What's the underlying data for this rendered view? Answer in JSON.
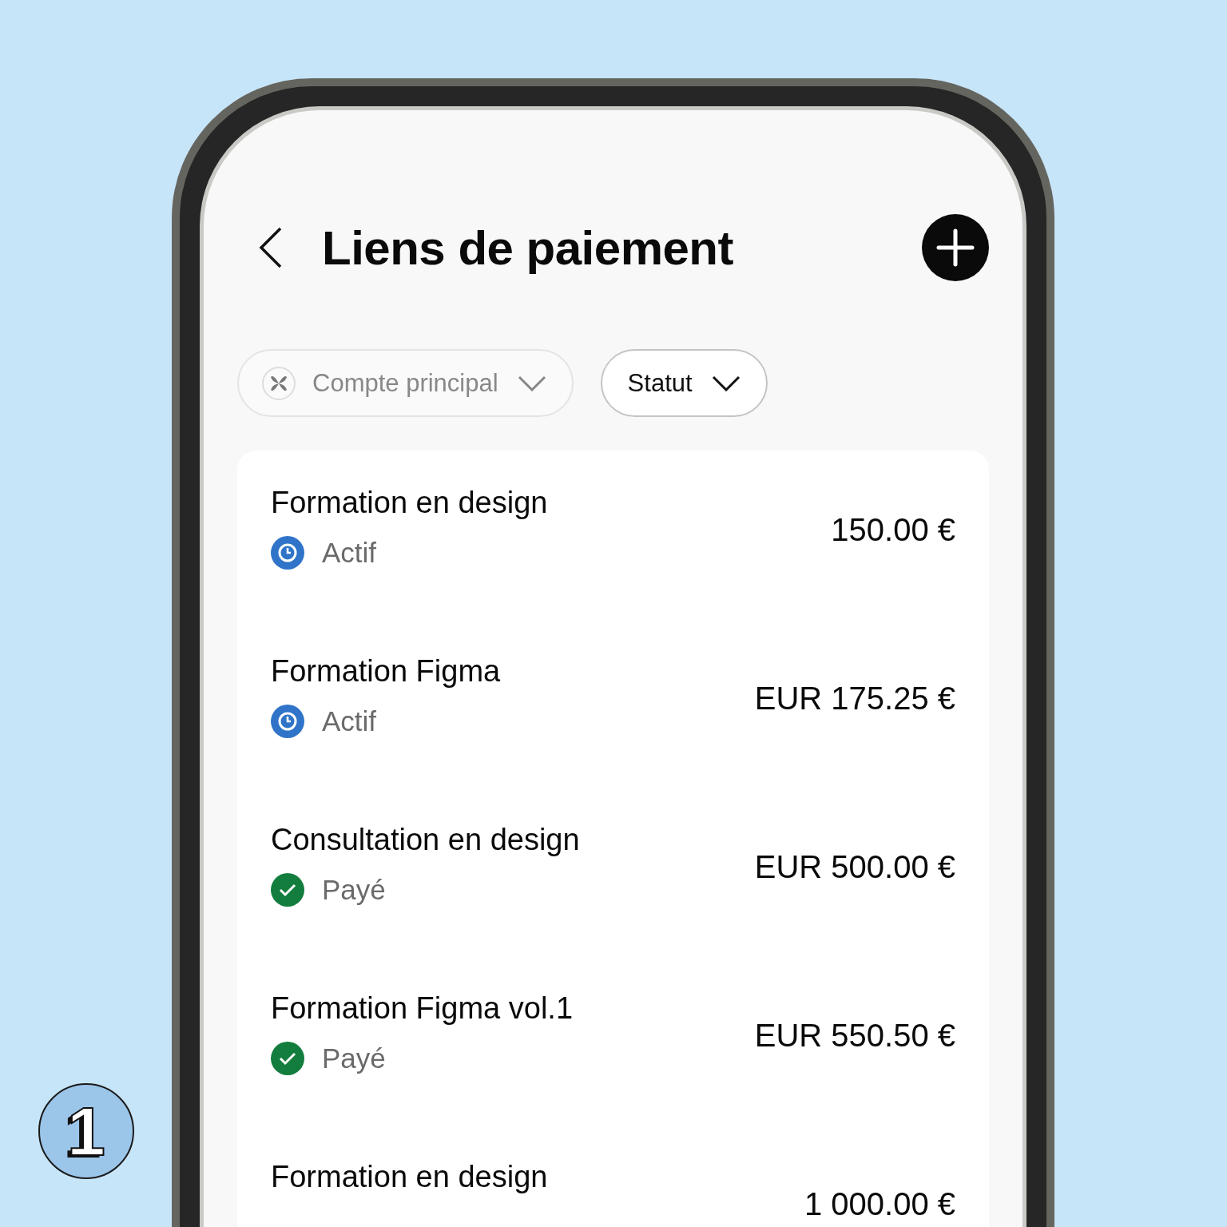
{
  "header": {
    "title": "Liens de paiement"
  },
  "filters": [
    {
      "label": "Compte principal",
      "kind": "account"
    },
    {
      "label": "Statut",
      "kind": "plain"
    }
  ],
  "links": [
    {
      "name": "Formation en design",
      "amount": "150.00 €",
      "status": {
        "label": "Actif",
        "kind": "active"
      }
    },
    {
      "name": "Formation Figma",
      "amount": "EUR 175.25 €",
      "status": {
        "label": "Actif",
        "kind": "active"
      }
    },
    {
      "name": "Consultation en design",
      "amount": "EUR 500.00 €",
      "status": {
        "label": "Payé",
        "kind": "paid"
      }
    },
    {
      "name": "Formation Figma vol.1",
      "amount": "EUR 550.50 €",
      "status": {
        "label": "Payé",
        "kind": "paid"
      }
    },
    {
      "name": "Formation en design",
      "amount": "1 000.00 €"
    }
  ],
  "step_badge": "1"
}
